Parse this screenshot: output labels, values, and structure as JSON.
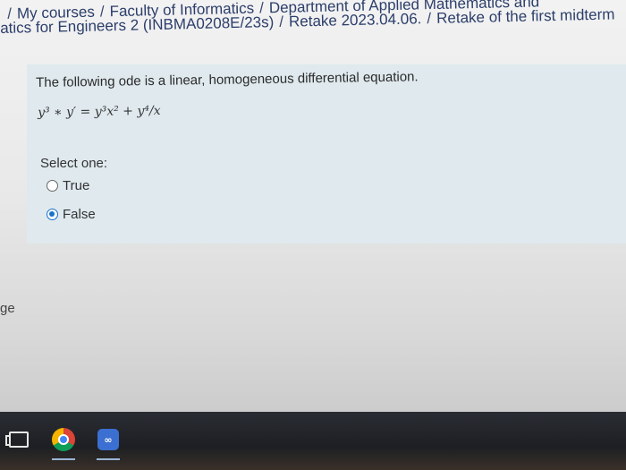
{
  "breadcrumb": {
    "line1": [
      "/",
      "My courses",
      "/",
      "Faculty of Informatics",
      "/",
      "Department of Applied Mathematics and"
    ],
    "line2": [
      "atics for Engineers 2 (INBMA0208E/23s)",
      "/",
      "Retake 2023.04.06.",
      "/",
      "Retake of the first midterm"
    ]
  },
  "question": {
    "text": "The following ode is a linear, homogeneous differential equation.",
    "formula": "y³ ∗ y′ = y³x² + y⁴/x",
    "select_label": "Select one:",
    "options": [
      {
        "label": "True",
        "selected": false
      },
      {
        "label": "False",
        "selected": true
      }
    ]
  },
  "side": {
    "text": "ge"
  },
  "taskbar": {
    "items": [
      "task-view-icon",
      "chrome-icon",
      "teams-icon"
    ]
  },
  "colors": {
    "radio_selected": "#1a73c9",
    "question_bg": "#dfe9ee",
    "breadcrumb_text": "#2c3e6b"
  }
}
